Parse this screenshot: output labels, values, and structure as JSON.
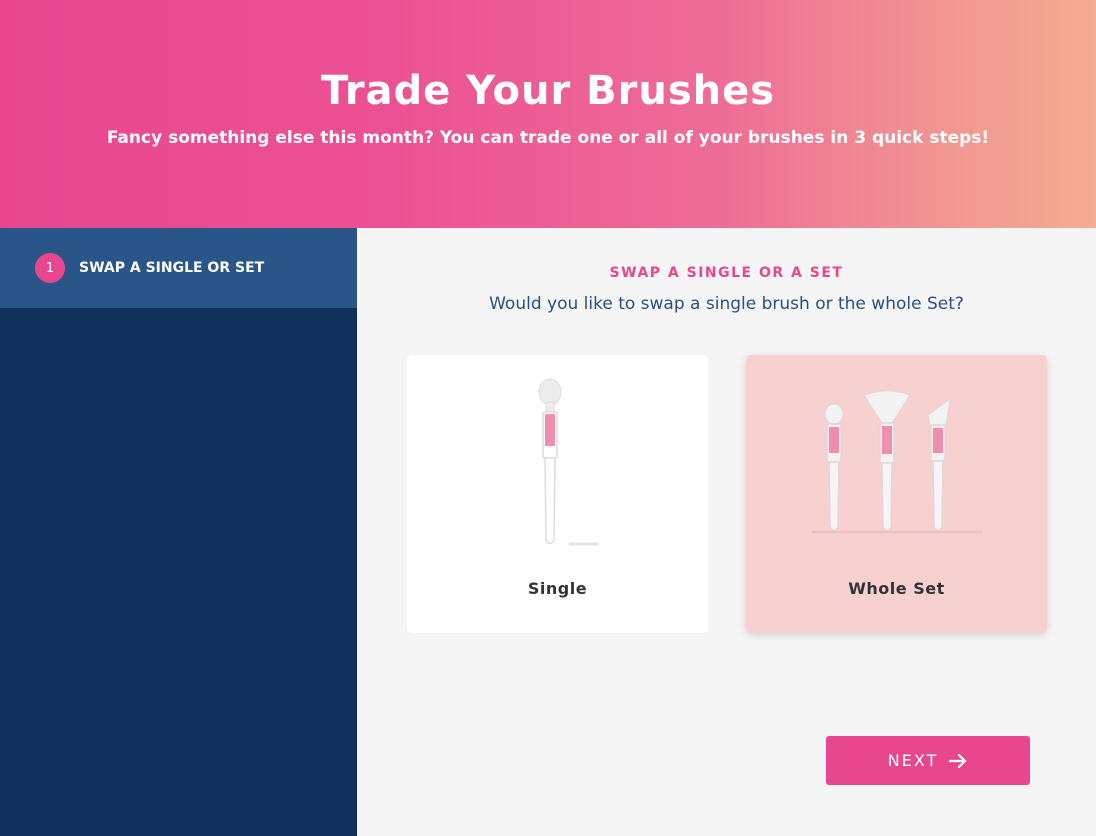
{
  "header": {
    "title": "Trade Your Brushes",
    "subtitle": "Fancy something else this month? You can trade one or all of your brushes in 3 quick steps!"
  },
  "sidebar": {
    "steps": [
      {
        "number": "1",
        "label": "SWAP A SINGLE OR SET",
        "active": true
      }
    ]
  },
  "main": {
    "section_title": "SWAP A SINGLE OR A SET",
    "question": "Would you like to swap a single brush or the whole Set?",
    "options": [
      {
        "label": "Single",
        "icon": "single-brush-icon",
        "selected": false
      },
      {
        "label": "Whole Set",
        "icon": "brush-set-icon",
        "selected": true
      }
    ],
    "next_label": "NEXT",
    "next_icon": "arrow-right-icon"
  },
  "colors": {
    "accent": "#e8478e",
    "sidebar": "#12305c",
    "sidebar_active": "#2a5588",
    "selected_card": "#f7d0d0"
  }
}
